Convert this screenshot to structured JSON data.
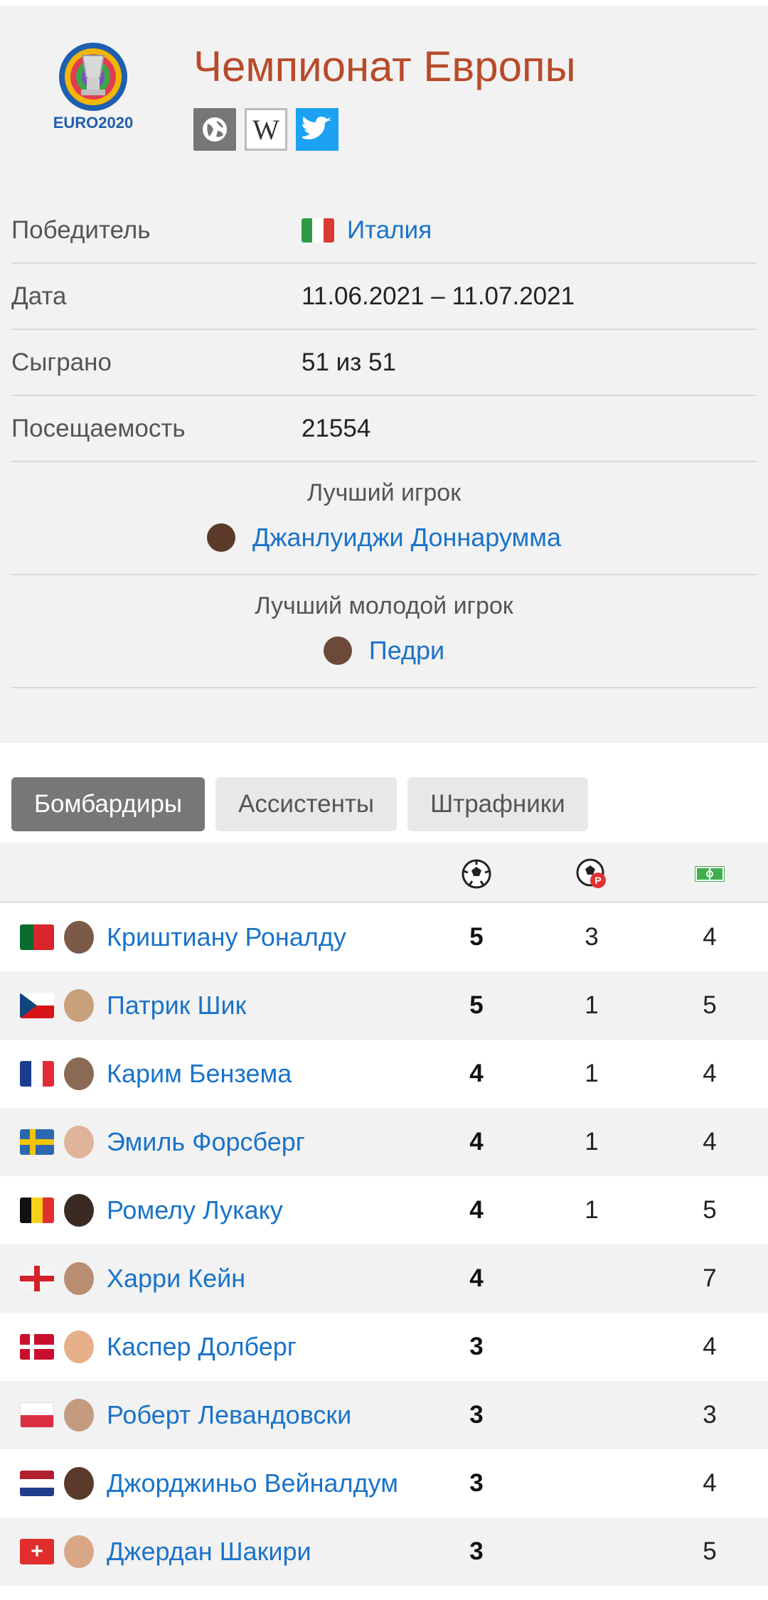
{
  "tournament": {
    "title": "Чемпионат Европы",
    "logo_text": "EURO2020",
    "links": [
      "globe-icon",
      "wikipedia-icon",
      "twitter-icon"
    ]
  },
  "info": {
    "winner_label": "Победитель",
    "winner_value": "Италия",
    "date_label": "Дата",
    "date_value": "11.06.2021 – 11.07.2021",
    "played_label": "Сыграно",
    "played_value": "51 из 51",
    "attendance_label": "Посещаемость",
    "attendance_value": "21554",
    "best_player_label": "Лучший игрок",
    "best_player_value": "Джанлуиджи Доннарумма",
    "best_young_label": "Лучший молодой игрок",
    "best_young_value": "Педри"
  },
  "tabs": [
    "Бомбардиры",
    "Ассистенты",
    "Штрафники"
  ],
  "table": {
    "columns": [
      "goals-icon",
      "penalty-goals-icon",
      "matches-icon"
    ],
    "rows": [
      {
        "name": "Криштиану Роналду",
        "country": "Portugal",
        "goals": "5",
        "penalties": "3",
        "matches": "4"
      },
      {
        "name": "Патрик Шик",
        "country": "Czechia",
        "goals": "5",
        "penalties": "1",
        "matches": "5"
      },
      {
        "name": "Карим Бензема",
        "country": "France",
        "goals": "4",
        "penalties": "1",
        "matches": "4"
      },
      {
        "name": "Эмиль Форсберг",
        "country": "Sweden",
        "goals": "4",
        "penalties": "1",
        "matches": "4"
      },
      {
        "name": "Ромелу Лукаку",
        "country": "Belgium",
        "goals": "4",
        "penalties": "1",
        "matches": "5"
      },
      {
        "name": "Харри Кейн",
        "country": "England",
        "goals": "4",
        "penalties": "",
        "matches": "7"
      },
      {
        "name": "Каспер Долберг",
        "country": "Denmark",
        "goals": "3",
        "penalties": "",
        "matches": "4"
      },
      {
        "name": "Роберт Левандовски",
        "country": "Poland",
        "goals": "3",
        "penalties": "",
        "matches": "3"
      },
      {
        "name": "Джорджиньо Вейналдум",
        "country": "Netherlands",
        "goals": "3",
        "penalties": "",
        "matches": "4"
      },
      {
        "name": "Джердан Шакири",
        "country": "Switzerland",
        "goals": "3",
        "penalties": "",
        "matches": "5"
      }
    ]
  }
}
